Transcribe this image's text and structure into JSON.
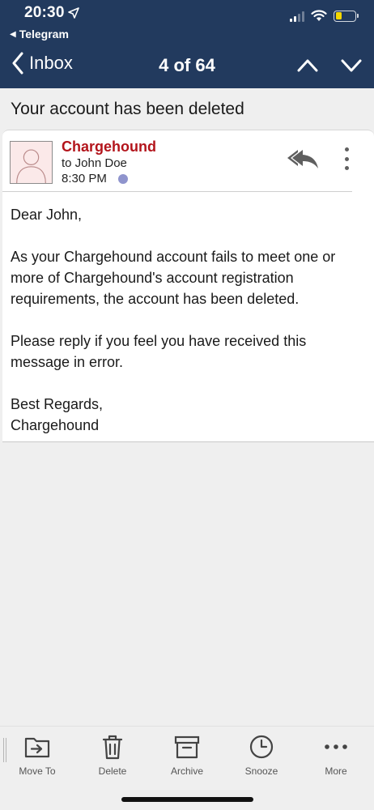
{
  "status_bar": {
    "time": "20:30",
    "back_app": "Telegram",
    "battery_color": "#f5d800"
  },
  "nav": {
    "back_label": "Inbox",
    "counter": "4 of 64",
    "prev_icon": "chevron-up-icon",
    "next_icon": "chevron-down-icon"
  },
  "subject": "Your account has been deleted",
  "message": {
    "sender": "Chargehound",
    "sender_color": "#b3141b",
    "recipient": "to John Doe",
    "time": "8:30 PM",
    "body": [
      "Dear John,",
      "As your Chargehound account fails to meet one or more of Chargehound's account registration requirements, the account has been deleted.",
      "Please reply if you feel you have received this message in error.",
      "Best Regards,",
      "Chargehound"
    ]
  },
  "toolbar": {
    "move_to": "Move To",
    "delete": "Delete",
    "archive": "Archive",
    "snooze": "Snooze",
    "more": "More"
  },
  "colors": {
    "header_bg": "#223a5e",
    "unread_dot": "#8f94cd"
  }
}
